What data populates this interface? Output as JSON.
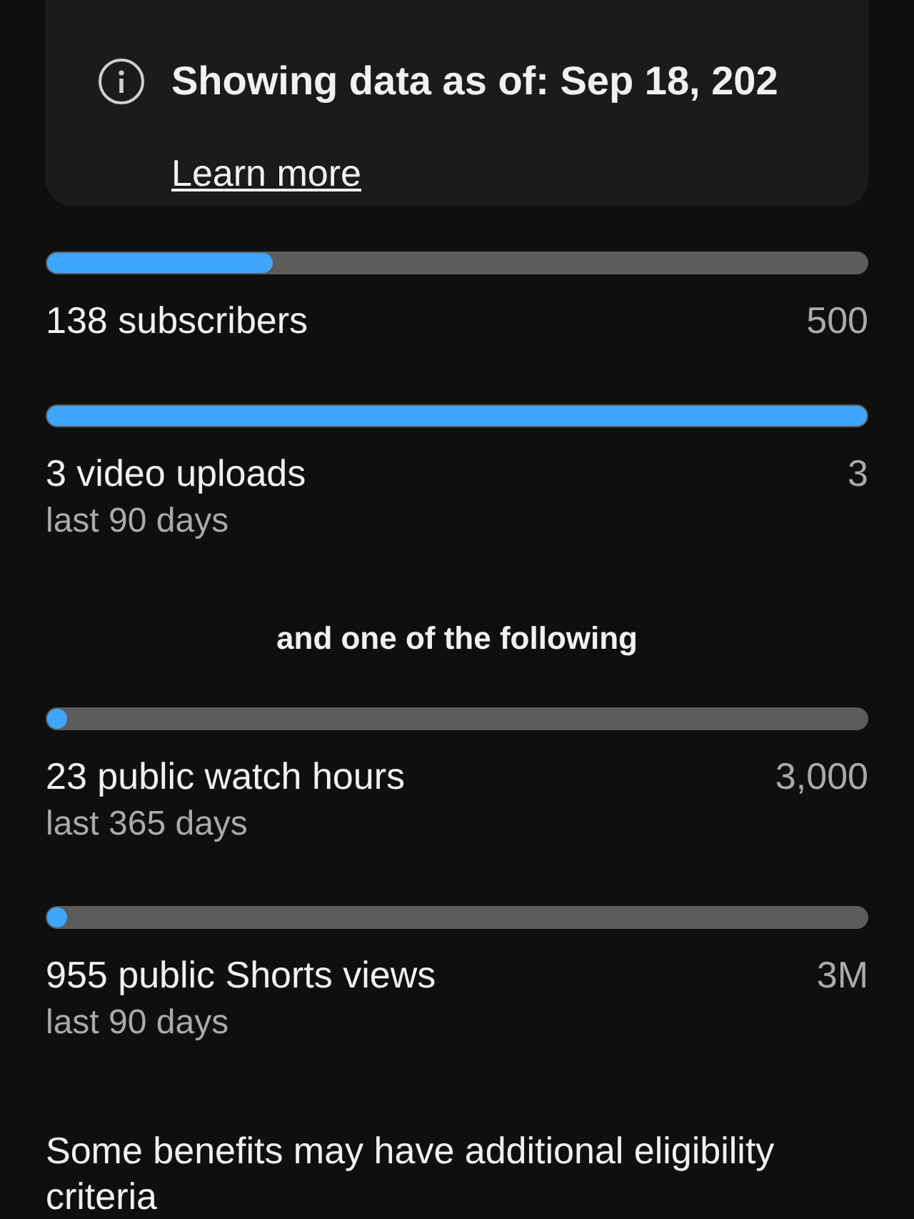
{
  "notice": {
    "title": "Showing data as of: Sep 18, 202",
    "link": "Learn more"
  },
  "requirements": [
    {
      "label": "138 subscribers",
      "target": "500",
      "level": 0.276
    },
    {
      "label": "3 video uploads",
      "target": "3",
      "period": "last 90 days",
      "level": 1
    }
  ],
  "separator": "and one of the following",
  "alternatives": [
    {
      "label": "23 public watch hours",
      "target": "3,000",
      "period": "last 365 days",
      "level": 0.008
    },
    {
      "label": "955 public Shorts views",
      "target": "3M",
      "period": "last 90 days",
      "level": 0.0003
    }
  ],
  "footnote": "Some benefits may have additional eligibility criteria"
}
